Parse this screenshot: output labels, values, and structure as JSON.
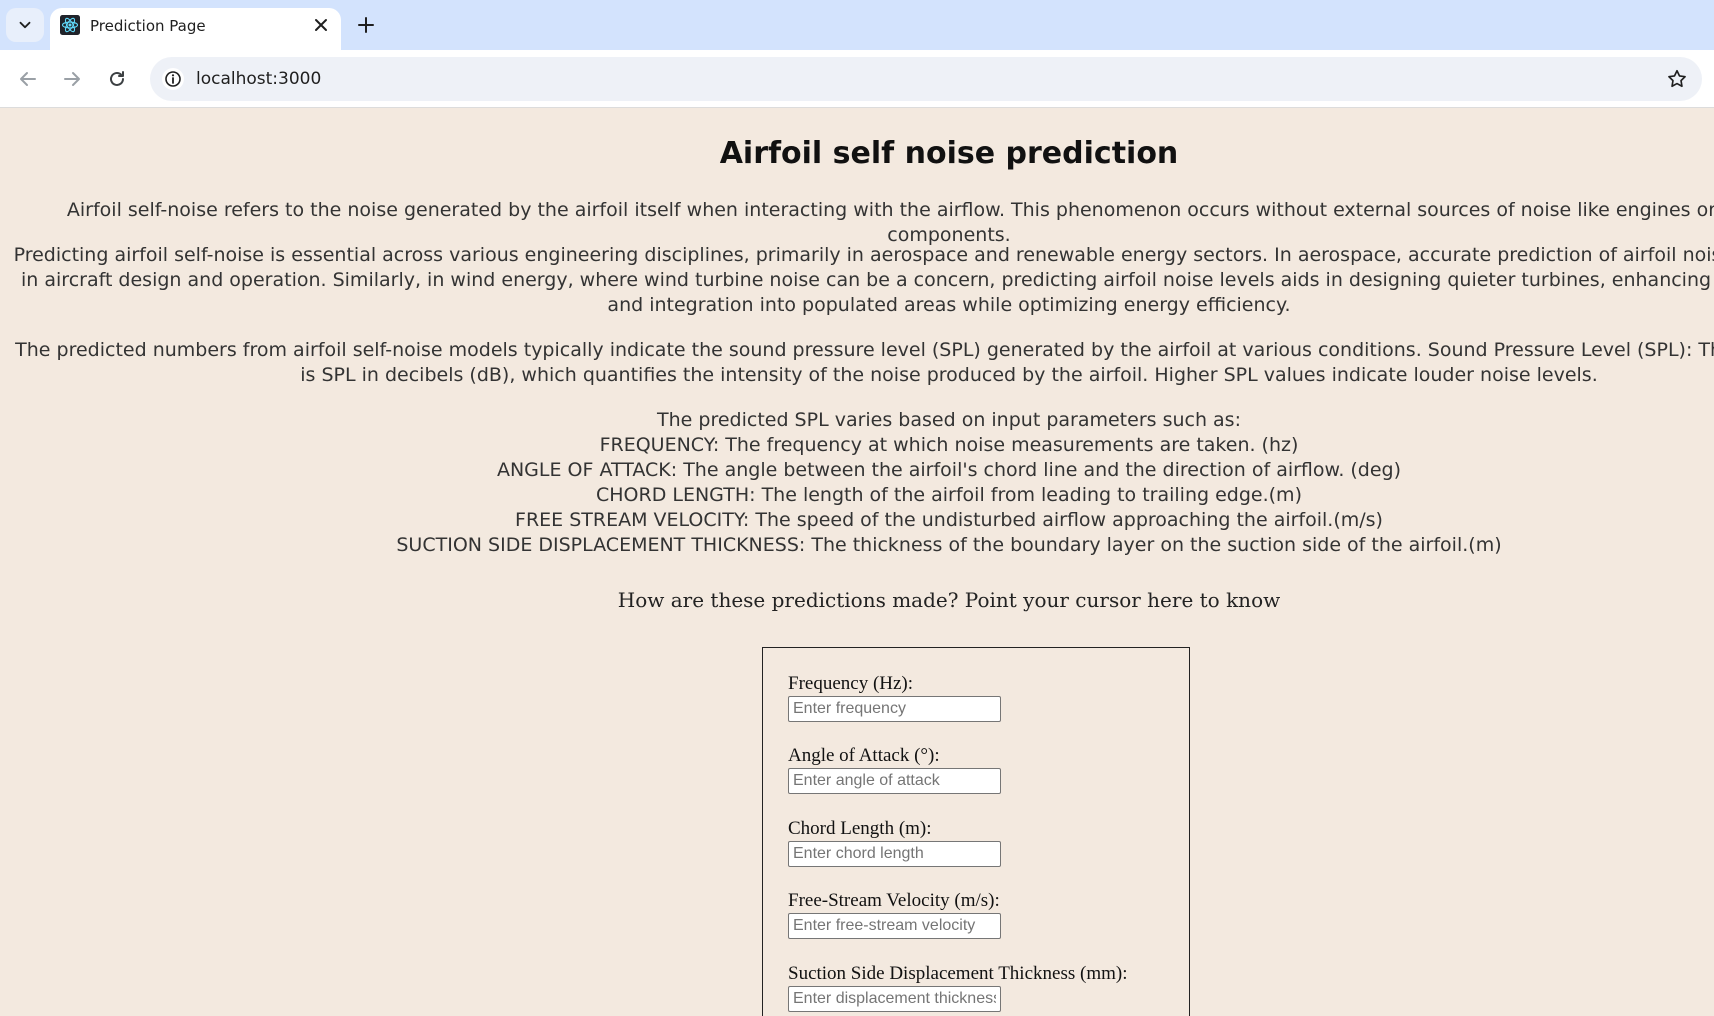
{
  "browser": {
    "tab_title": "Prediction Page",
    "url": "localhost:3000"
  },
  "page": {
    "title": "Airfoil self noise prediction",
    "intro": "Airfoil self-noise refers to the noise generated by the airfoil itself when interacting with the airflow. This phenomenon occurs without external sources of noise like engines or mechanical components.",
    "importance": "Predicting airfoil self-noise is essential across various engineering disciplines, primarily in aerospace and renewable energy sectors. In aerospace, accurate prediction of airfoil noise levels is crucial in aircraft design and operation. Similarly, in wind energy, where wind turbine noise can be a concern, predicting airfoil noise levels aids in designing quieter turbines, enhancing their acceptance and integration into populated areas while optimizing energy efficiency.",
    "spl_explanation": "The predicted numbers from airfoil self-noise models typically indicate the sound pressure level (SPL) generated by the airfoil at various conditions. Sound Pressure Level (SPL): The primary output is SPL in decibels (dB), which quantifies the intensity of the noise produced by the airfoil. Higher SPL values indicate louder noise levels.",
    "parameters": [
      "The predicted SPL varies based on input parameters such as:",
      "FREQUENCY: The frequency at which noise measurements are taken. (hz)",
      "ANGLE OF ATTACK: The angle between the airfoil's chord line and the direction of airflow. (deg)",
      "CHORD LENGTH: The length of the airfoil from leading to trailing edge.(m)",
      "FREE STREAM VELOCITY: The speed of the undisturbed airflow approaching the airfoil.(m/s)",
      "SUCTION SIDE DISPLACEMENT THICKNESS: The thickness of the boundary layer on the suction side of the airfoil.(m)"
    ],
    "how_link": "How are these predictions made? Point your cursor here to know"
  },
  "form": {
    "fields": [
      {
        "label": "Frequency (Hz):",
        "placeholder": "Enter frequency",
        "value": ""
      },
      {
        "label": "Angle of Attack (°):",
        "placeholder": "Enter angle of attack",
        "value": ""
      },
      {
        "label": "Chord Length (m):",
        "placeholder": "Enter chord length",
        "value": ""
      },
      {
        "label": "Free-Stream Velocity (m/s):",
        "placeholder": "Enter free-stream velocity",
        "value": ""
      },
      {
        "label": "Suction Side Displacement Thickness (mm):",
        "placeholder": "Enter displacement thickness",
        "value": ""
      }
    ]
  },
  "icons": {
    "tab_search": "chevron-down-icon",
    "favicon": "react-icon",
    "close": "close-icon",
    "new_tab": "plus-icon",
    "back": "back-arrow-icon",
    "forward": "forward-arrow-icon",
    "reload": "reload-icon",
    "site_info": "info-icon",
    "bookmark": "star-icon"
  },
  "colors": {
    "page_background": "#f3e9df",
    "tabstrip": "#d3e3fd",
    "react_logo": "#61dafb"
  }
}
